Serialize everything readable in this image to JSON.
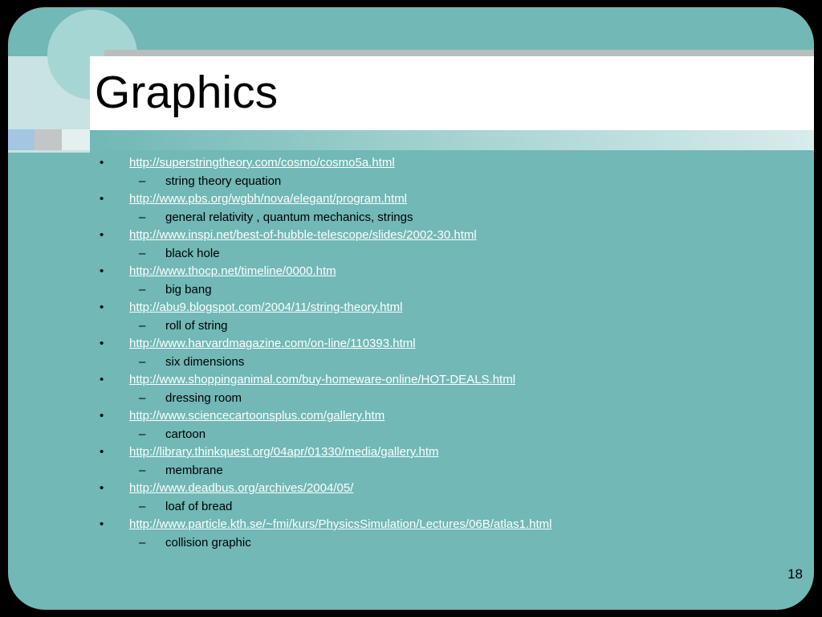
{
  "slide": {
    "title": "Graphics",
    "page_number": "18",
    "bullet_glyph": "•",
    "dash_glyph": "–",
    "items": [
      {
        "url": "http://superstringtheory.com/cosmo/cosmo5a.html",
        "desc": "string theory equation"
      },
      {
        "url": "http://www.pbs.org/wgbh/nova/elegant/program.html",
        "desc": "general relativity , quantum mechanics, strings"
      },
      {
        "url": "http://www.inspi.net/best-of-hubble-telescope/slides/2002-30.html",
        "desc": "black hole"
      },
      {
        "url": "http://www.thocp.net/timeline/0000.htm",
        "desc": "big bang"
      },
      {
        "url": "http://abu9.blogspot.com/2004/11/string-theory.html",
        "desc": "roll of string"
      },
      {
        "url": "http://www.harvardmagazine.com/on-line/110393.html",
        "desc": "six dimensions"
      },
      {
        "url": "http://www.shoppinganimal.com/buy-homeware-online/HOT-DEALS.html",
        "desc": "dressing room"
      },
      {
        "url": "http://www.sciencecartoonsplus.com/gallery.htm",
        "desc": "cartoon"
      },
      {
        "url": "http://library.thinkquest.org/04apr/01330/media/gallery.htm",
        "desc": "membrane"
      },
      {
        "url": "http://www.deadbus.org/archives/2004/05/",
        "desc": "loaf of bread"
      },
      {
        "url": "http://www.particle.kth.se/~fmi/kurs/PhysicsSimulation/Lectures/06B/atlas1.html",
        "desc": "collision graphic"
      }
    ]
  },
  "colors": {
    "background": "#71b8b6",
    "title_band": "#ffffff",
    "link": "#ffffff",
    "text": "#000000"
  }
}
